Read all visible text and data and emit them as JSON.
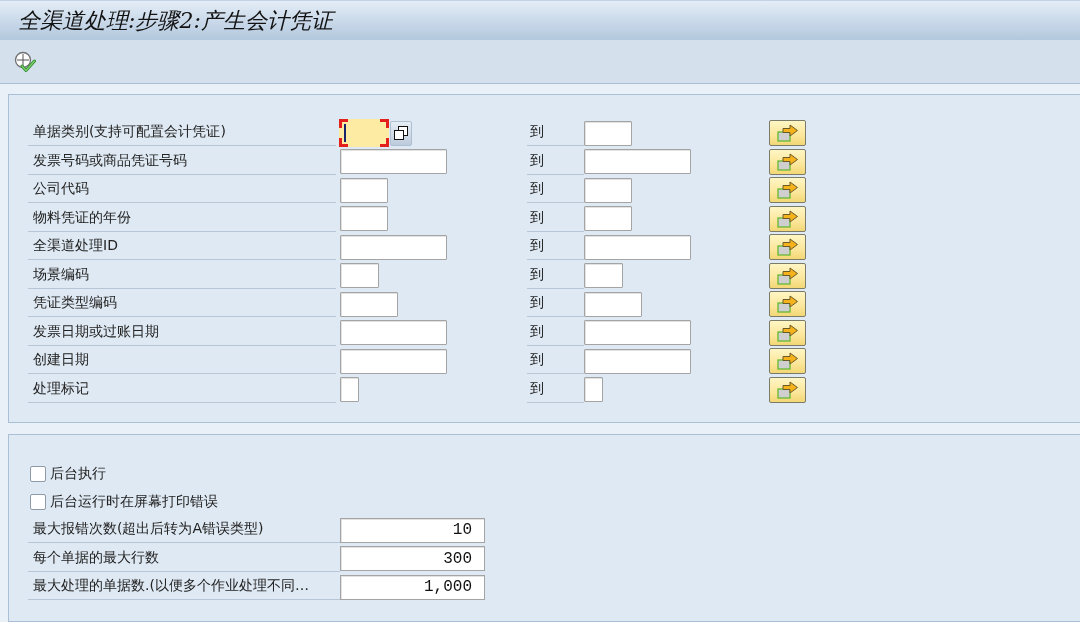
{
  "window": {
    "title": "全渠道处理:步骤2:产生会计凭证"
  },
  "selection_fields": [
    {
      "label": "单据类别(支持可配置会计凭证)",
      "kind": "code",
      "focused": true,
      "to_label": "到"
    },
    {
      "label": "发票号码或商品凭证号码",
      "kind": "text",
      "focused": false,
      "to_label": "到"
    },
    {
      "label": "公司代码",
      "kind": "code",
      "focused": false,
      "to_label": "到"
    },
    {
      "label": "物料凭证的年份",
      "kind": "code",
      "focused": false,
      "to_label": "到"
    },
    {
      "label": "全渠道处理ID",
      "kind": "text",
      "focused": false,
      "to_label": "到"
    },
    {
      "label": "场景编码",
      "kind": "short",
      "focused": false,
      "to_label": "到"
    },
    {
      "label": "凭证类型编码",
      "kind": "type",
      "focused": false,
      "to_label": "到"
    },
    {
      "label": "发票日期或过账日期",
      "kind": "date",
      "focused": false,
      "to_label": "到"
    },
    {
      "label": "创建日期",
      "kind": "date",
      "focused": false,
      "to_label": "到"
    },
    {
      "label": "处理标记",
      "kind": "flag",
      "focused": false,
      "to_label": "到"
    }
  ],
  "options": [
    {
      "label": "后台执行",
      "checked": false
    },
    {
      "label": "后台运行时在屏幕打印错误",
      "checked": false
    }
  ],
  "parameters": [
    {
      "label": "最大报错次数(超出后转为A错误类型)",
      "value": "10"
    },
    {
      "label": "每个单据的最大行数",
      "value": "300"
    },
    {
      "label": "最大处理的单据数.(以便多个作业处理不同…",
      "value": "1,000"
    }
  ]
}
